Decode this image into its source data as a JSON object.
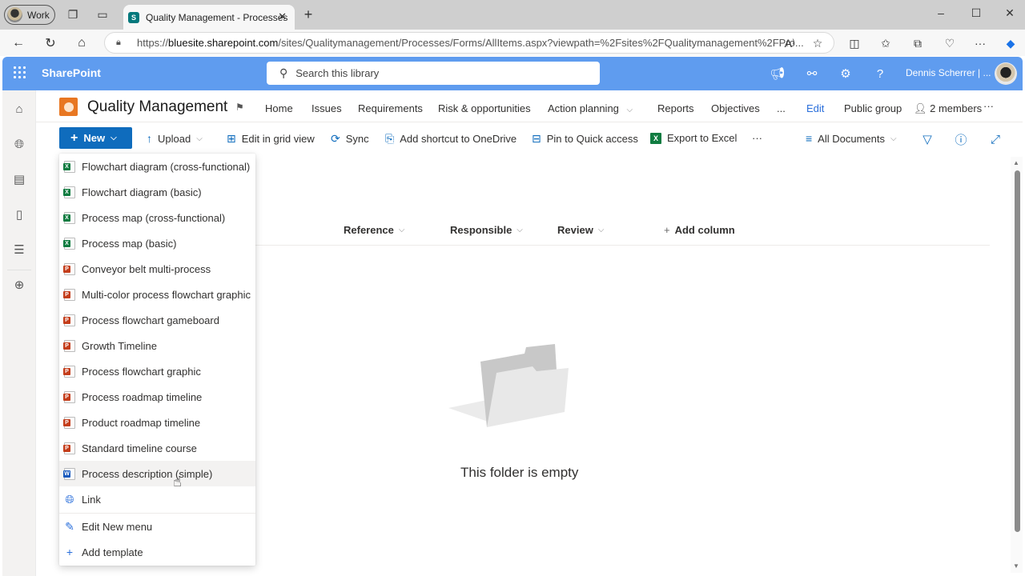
{
  "browser": {
    "profile_label": "Work",
    "tab_title": "Quality Management - Processes",
    "tab_favicon": "S",
    "url_prefix": "https://",
    "url_domain": "bluesite.sharepoint.com",
    "url_path": "/sites/Qualitymanagement/Processes/Forms/AllItems.aspx?viewpath=%2Fsites%2FQualitymanagement%2FPro..."
  },
  "sp_header": {
    "brand": "SharePoint",
    "search_placeholder": "Search this library",
    "user_name": "Dennis Scherrer | ..."
  },
  "site": {
    "title": "Quality Management",
    "nav": [
      "Home",
      "Issues",
      "Requirements",
      "Risk & opportunities",
      "Action planning",
      "Reports",
      "Objectives",
      "..."
    ],
    "edit_label": "Edit",
    "group_label": "Public group",
    "members_label": "2 members",
    "more_label": "···"
  },
  "commandbar": {
    "new_label": "New",
    "upload_label": "Upload",
    "grid_label": "Edit in grid view",
    "sync_label": "Sync",
    "shortcut_label": "Add shortcut to OneDrive",
    "pin_label": "Pin to Quick access",
    "export_label": "Export to Excel",
    "more_label": "···",
    "view_label": "All Documents"
  },
  "columns": {
    "reference": "Reference",
    "responsible": "Responsible",
    "review": "Review",
    "add_column": "Add column"
  },
  "empty_state": {
    "message": "This folder is empty"
  },
  "new_menu": {
    "items": [
      {
        "label": "Flowchart diagram (cross-functional)",
        "type": "excel"
      },
      {
        "label": "Flowchart diagram (basic)",
        "type": "excel"
      },
      {
        "label": "Process map (cross-functional)",
        "type": "excel"
      },
      {
        "label": "Process map (basic)",
        "type": "excel"
      },
      {
        "label": "Conveyor belt multi-process",
        "type": "powerpoint"
      },
      {
        "label": "Multi-color process flowchart graphic",
        "type": "powerpoint"
      },
      {
        "label": "Process flowchart gameboard",
        "type": "powerpoint"
      },
      {
        "label": "Growth Timeline",
        "type": "powerpoint"
      },
      {
        "label": "Process flowchart graphic",
        "type": "powerpoint"
      },
      {
        "label": "Process roadmap timeline",
        "type": "powerpoint"
      },
      {
        "label": "Product roadmap timeline",
        "type": "powerpoint"
      },
      {
        "label": "Standard timeline course",
        "type": "powerpoint"
      },
      {
        "label": "Process description (simple)",
        "type": "word",
        "hovered": true
      },
      {
        "label": "Link",
        "type": "link"
      }
    ],
    "edit_menu_label": "Edit New menu",
    "add_template_label": "Add template"
  },
  "colors": {
    "sp_header_bg": "#5f9cef",
    "primary_button": "#0f6cbd",
    "site_logo": "#e87722",
    "excel": "#107c41",
    "powerpoint": "#c43e1c",
    "word": "#185abd"
  }
}
